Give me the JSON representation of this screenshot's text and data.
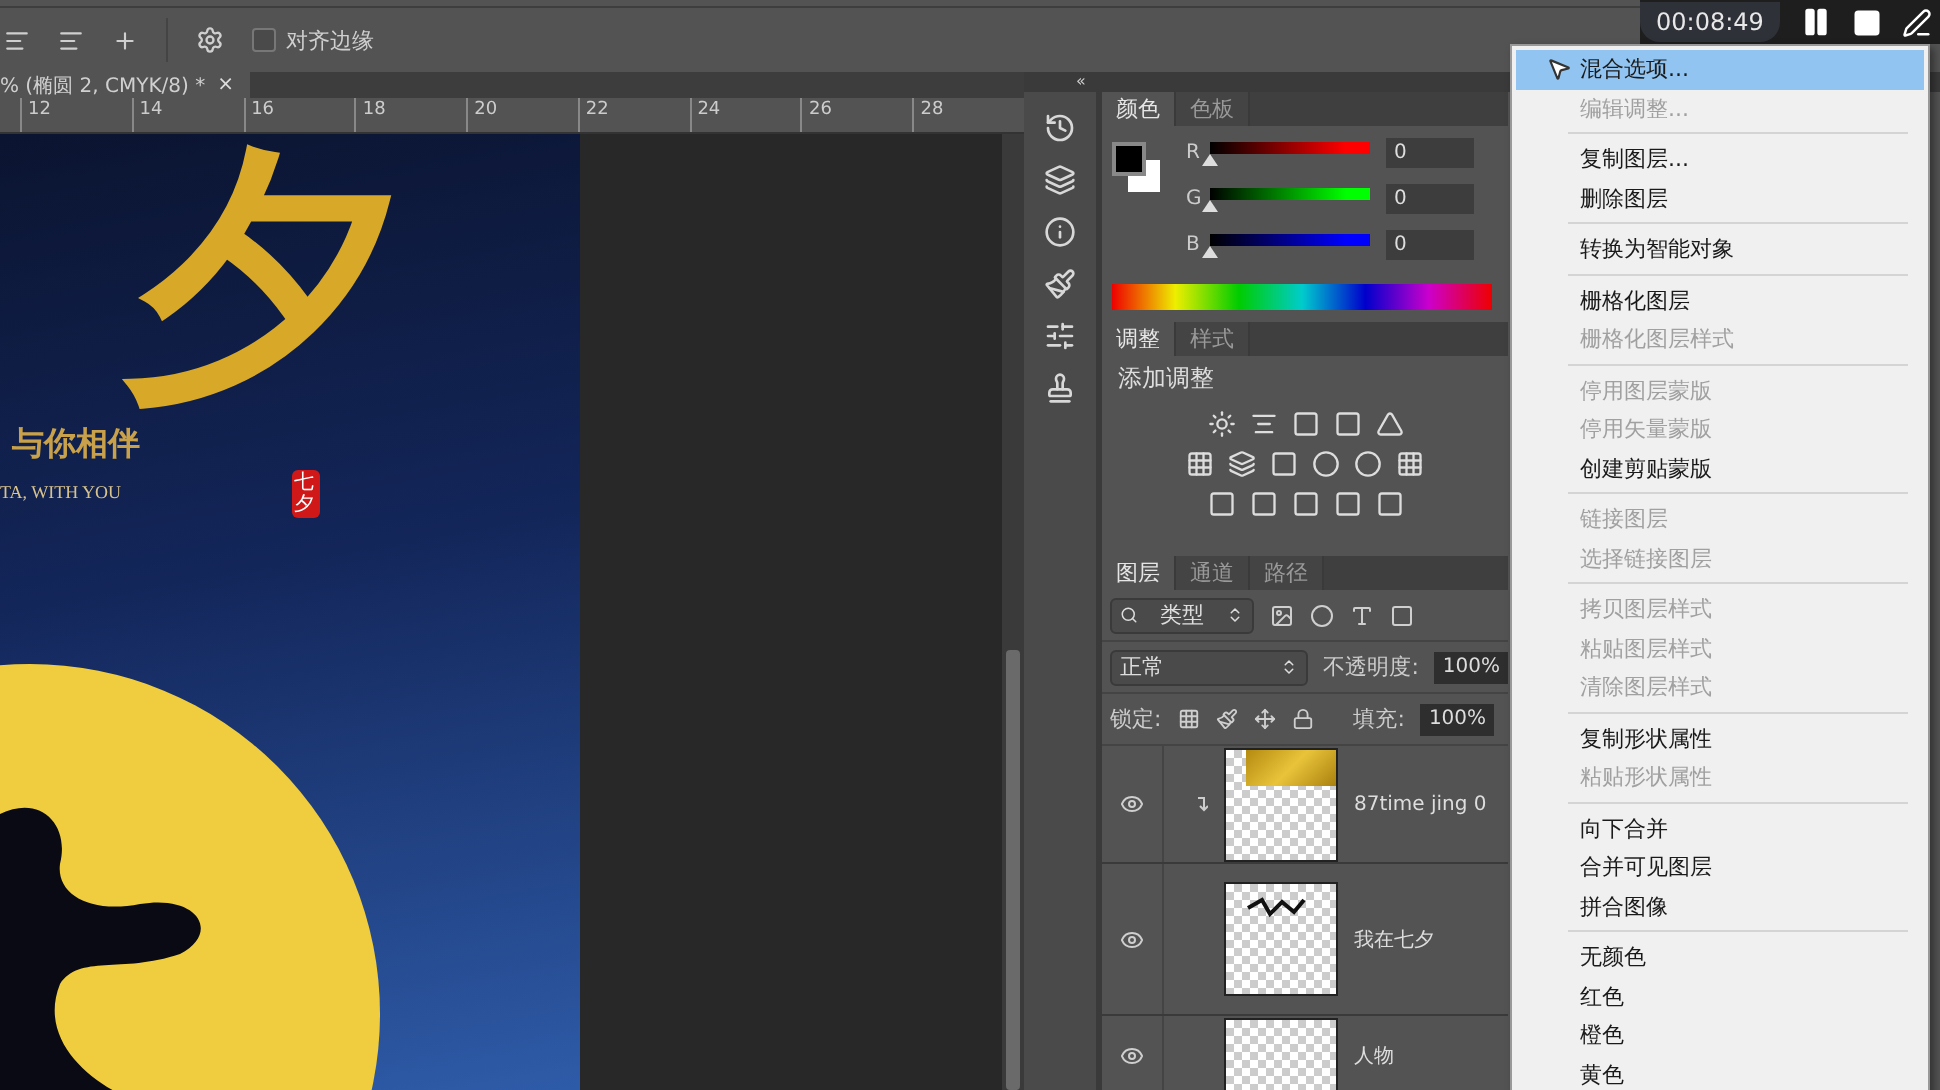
{
  "options_bar": {
    "align_edges": {
      "label": "对齐边缘",
      "checked": false
    }
  },
  "recorder": {
    "time": "00:08:49"
  },
  "document_tab": {
    "title": "% (椭圆 2, CMYK/8) *",
    "close": "×"
  },
  "ruler": {
    "ticks": [
      "12",
      "14",
      "16",
      "18",
      "20",
      "22",
      "24",
      "26",
      "28"
    ]
  },
  "poster": {
    "title": "夕",
    "subtitle": "与你相伴",
    "tagline": "TA, WITH YOU",
    "seal": "七夕"
  },
  "panel_dock": {
    "collapse": "«"
  },
  "color_panel": {
    "tabs": [
      {
        "label": "颜色",
        "selected": true
      },
      {
        "label": "色板",
        "selected": false
      }
    ],
    "channels": [
      {
        "name": "R",
        "color": "#ff0000",
        "level": 0,
        "value": "0"
      },
      {
        "name": "G",
        "color": "#00ff00",
        "level": 0,
        "value": "0"
      },
      {
        "name": "B",
        "color": "#0000ff",
        "level": 0,
        "value": "0"
      }
    ]
  },
  "adjustments_panel": {
    "tabs": [
      {
        "label": "调整",
        "selected": true
      },
      {
        "label": "样式",
        "selected": false
      }
    ],
    "heading": "添加调整"
  },
  "layers_panel": {
    "tabs": [
      {
        "label": "图层",
        "selected": true
      },
      {
        "label": "通道",
        "selected": false
      },
      {
        "label": "路径",
        "selected": false
      }
    ],
    "filter": "类型",
    "blend_mode": "正常",
    "opacity_label": "不透明度:",
    "opacity": "100%",
    "lock_label": "锁定:",
    "fill_label": "填充:",
    "fill": "100%",
    "layers": [
      {
        "name": "87time jing 0",
        "visible": true,
        "clipped": true,
        "kind": "texture"
      },
      {
        "name": "我在七夕",
        "visible": true,
        "clipped": false,
        "kind": "lettering"
      },
      {
        "name": "人物",
        "visible": true,
        "clipped": false,
        "kind": "figure"
      }
    ]
  },
  "context_menu": {
    "groups": [
      [
        {
          "label": "混合选项...",
          "disabled": false,
          "selected": true
        },
        {
          "label": "编辑调整...",
          "disabled": true,
          "selected": false
        }
      ],
      [
        {
          "label": "复制图层...",
          "disabled": false,
          "selected": false
        },
        {
          "label": "删除图层",
          "disabled": false,
          "selected": false
        }
      ],
      [
        {
          "label": "转换为智能对象",
          "disabled": false,
          "selected": false
        }
      ],
      [
        {
          "label": "栅格化图层",
          "disabled": false,
          "selected": false
        },
        {
          "label": "栅格化图层样式",
          "disabled": true,
          "selected": false
        }
      ],
      [
        {
          "label": "停用图层蒙版",
          "disabled": true,
          "selected": false
        },
        {
          "label": "停用矢量蒙版",
          "disabled": true,
          "selected": false
        },
        {
          "label": "创建剪贴蒙版",
          "disabled": false,
          "selected": false
        }
      ],
      [
        {
          "label": "链接图层",
          "disabled": true,
          "selected": false
        },
        {
          "label": "选择链接图层",
          "disabled": true,
          "selected": false
        }
      ],
      [
        {
          "label": "拷贝图层样式",
          "disabled": true,
          "selected": false
        },
        {
          "label": "粘贴图层样式",
          "disabled": true,
          "selected": false
        },
        {
          "label": "清除图层样式",
          "disabled": true,
          "selected": false
        }
      ],
      [
        {
          "label": "复制形状属性",
          "disabled": false,
          "selected": false
        },
        {
          "label": "粘贴形状属性",
          "disabled": true,
          "selected": false
        }
      ],
      [
        {
          "label": "向下合并",
          "disabled": false,
          "selected": false
        },
        {
          "label": "合并可见图层",
          "disabled": false,
          "selected": false
        },
        {
          "label": "拼合图像",
          "disabled": false,
          "selected": false
        }
      ],
      [
        {
          "label": "无颜色",
          "disabled": false,
          "selected": false
        },
        {
          "label": "红色",
          "disabled": false,
          "selected": false
        },
        {
          "label": "橙色",
          "disabled": false,
          "selected": false
        },
        {
          "label": "黄色",
          "disabled": false,
          "selected": false
        }
      ]
    ]
  }
}
